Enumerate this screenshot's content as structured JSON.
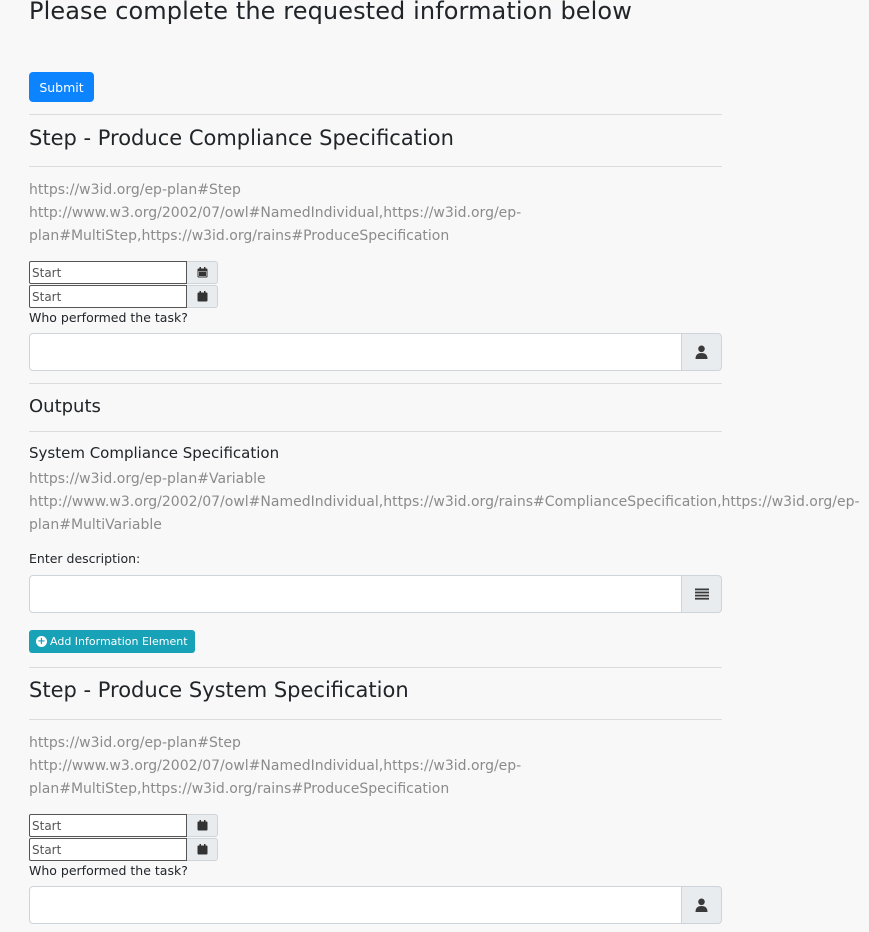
{
  "page": {
    "title": "Please complete the requested information below",
    "submit_label": "Submit"
  },
  "steps": [
    {
      "title": "Step - Produce Compliance Specification",
      "uri_lines": [
        "https://w3id.org/ep-plan#Step",
        "http://www.w3.org/2002/07/owl#NamedIndividual,https://w3id.org/ep-",
        "plan#MultiStep,https://w3id.org/rains#ProduceSpecification"
      ],
      "start_placeholder_1": "Start",
      "start_placeholder_2": "Start",
      "performer_label": "Who performed the task?",
      "performer_value": "",
      "outputs_heading": "Outputs",
      "output": {
        "title": "System Compliance Specification",
        "uri_lines": [
          "https://w3id.org/ep-plan#Variable",
          "http://www.w3.org/2002/07/owl#NamedIndividual,https://w3id.org/rains#ComplianceSpecification,https://w3id.org/ep-",
          "plan#MultiVariable"
        ],
        "description_label": "Enter description:",
        "description_value": "",
        "add_button_label": "Add Information Element"
      }
    },
    {
      "title": "Step - Produce System Specification",
      "uri_lines": [
        "https://w3id.org/ep-plan#Step",
        "http://www.w3.org/2002/07/owl#NamedIndividual,https://w3id.org/ep-",
        "plan#MultiStep,https://w3id.org/rains#ProduceSpecification"
      ],
      "start_placeholder_1": "Start",
      "start_placeholder_2": "Start",
      "performer_label": "Who performed the task?",
      "performer_value": ""
    }
  ],
  "icons": {
    "calendar": "calendar-icon",
    "user": "user-icon",
    "list": "list-icon",
    "plus": "plus-circle-icon"
  },
  "colors": {
    "submit": "#0d84ff",
    "add_button": "#17a2b8",
    "uri_text": "#8b8b8b"
  }
}
